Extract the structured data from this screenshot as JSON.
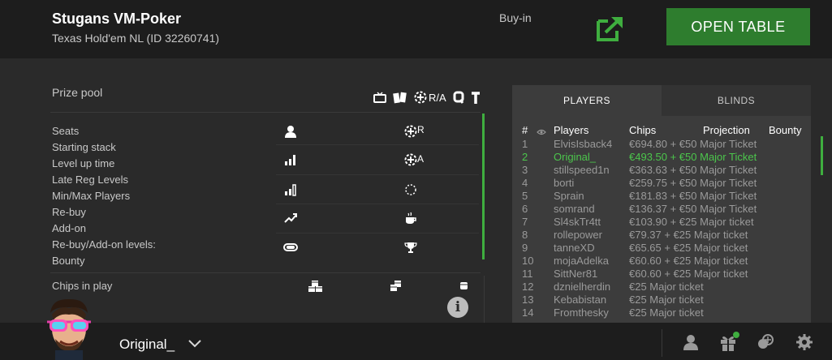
{
  "header": {
    "title": "Stugans VM-Poker",
    "subtitle": "Texas Hold'em NL (ID 32260741)",
    "buyin_label": "Buy-in",
    "open_table_label": "OPEN TABLE"
  },
  "info": {
    "prize_pool_label": "Prize pool",
    "ra_label": "R/A",
    "rows": [
      "Seats",
      "Starting stack",
      "Level up time",
      "Late Reg Levels",
      "Min/Max Players",
      "Re-buy",
      "Add-on",
      "Re-buy/Add-on levels:",
      "Bounty"
    ],
    "r_label": "R",
    "a_label": "A",
    "chips_in_play_label": "Chips in play",
    "info_symbol": "i"
  },
  "tabs": [
    {
      "label": "PLAYERS",
      "active": true
    },
    {
      "label": "BLINDS",
      "active": false
    }
  ],
  "players_table": {
    "headers": {
      "num": "#",
      "players": "Players",
      "chips": "Chips",
      "projection": "Projection",
      "bounty": "Bounty"
    },
    "rows": [
      {
        "num": "1",
        "name": "ElvisIsback4",
        "chips": "€694.80 + €50 Major Ticket"
      },
      {
        "num": "2",
        "name": "Original_",
        "chips": "€493.50 + €50 Major Ticket"
      },
      {
        "num": "3",
        "name": "stillspeed1n",
        "chips": "€363.63 + €50 Major Ticket"
      },
      {
        "num": "4",
        "name": "borti",
        "chips": "€259.75 + €50 Major Ticket"
      },
      {
        "num": "5",
        "name": "Sprain",
        "chips": "€181.83 + €50 Major Ticket"
      },
      {
        "num": "6",
        "name": "somrand",
        "chips": "€136.37 + €50 Major Ticket"
      },
      {
        "num": "7",
        "name": "Sl4skTr4tt",
        "chips": "€103.90 + €25 Major ticket"
      },
      {
        "num": "8",
        "name": "rollepower",
        "chips": "€79.37 + €25 Major ticket"
      },
      {
        "num": "9",
        "name": "tanneXD",
        "chips": "€65.65 + €25 Major ticket"
      },
      {
        "num": "10",
        "name": "mojaAdelka",
        "chips": "€60.60 + €25 Major ticket"
      },
      {
        "num": "11",
        "name": "SittNer81",
        "chips": "€60.60 + €25 Major ticket"
      },
      {
        "num": "12",
        "name": "dznielherdin",
        "chips": "€25 Major ticket"
      },
      {
        "num": "13",
        "name": "Kebabistan",
        "chips": "€25 Major ticket"
      },
      {
        "num": "14",
        "name": "Fromthesky",
        "chips": "€25 Major ticket"
      }
    ]
  },
  "footer": {
    "username": "Original_"
  },
  "colors": {
    "accent_green": "#3fae3f",
    "button_green": "#2e7d2e",
    "header_bg": "#1d1d1d",
    "panel_bg": "#2a2a2a"
  }
}
